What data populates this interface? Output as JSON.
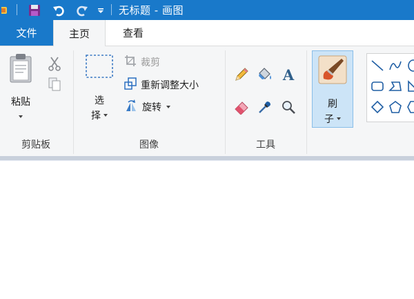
{
  "window": {
    "title": "无标题 - 画图"
  },
  "tabs": {
    "file": "文件",
    "home": "主页",
    "view": "查看"
  },
  "clipboard": {
    "paste_line1": "粘贴",
    "group_label": "剪贴板"
  },
  "image": {
    "select_line1": "选",
    "select_line2": "择",
    "crop": "裁剪",
    "resize": "重新调整大小",
    "rotate": "旋转",
    "group_label": "图像"
  },
  "tools": {
    "group_label": "工具"
  },
  "brushes": {
    "line1": "刷",
    "line2": "子"
  },
  "colors": {
    "accent": "#1979ca",
    "ribbon_bg": "#f5f6f7",
    "selected_bg": "#cce4f7",
    "icon_blue": "#2a6fc0"
  }
}
